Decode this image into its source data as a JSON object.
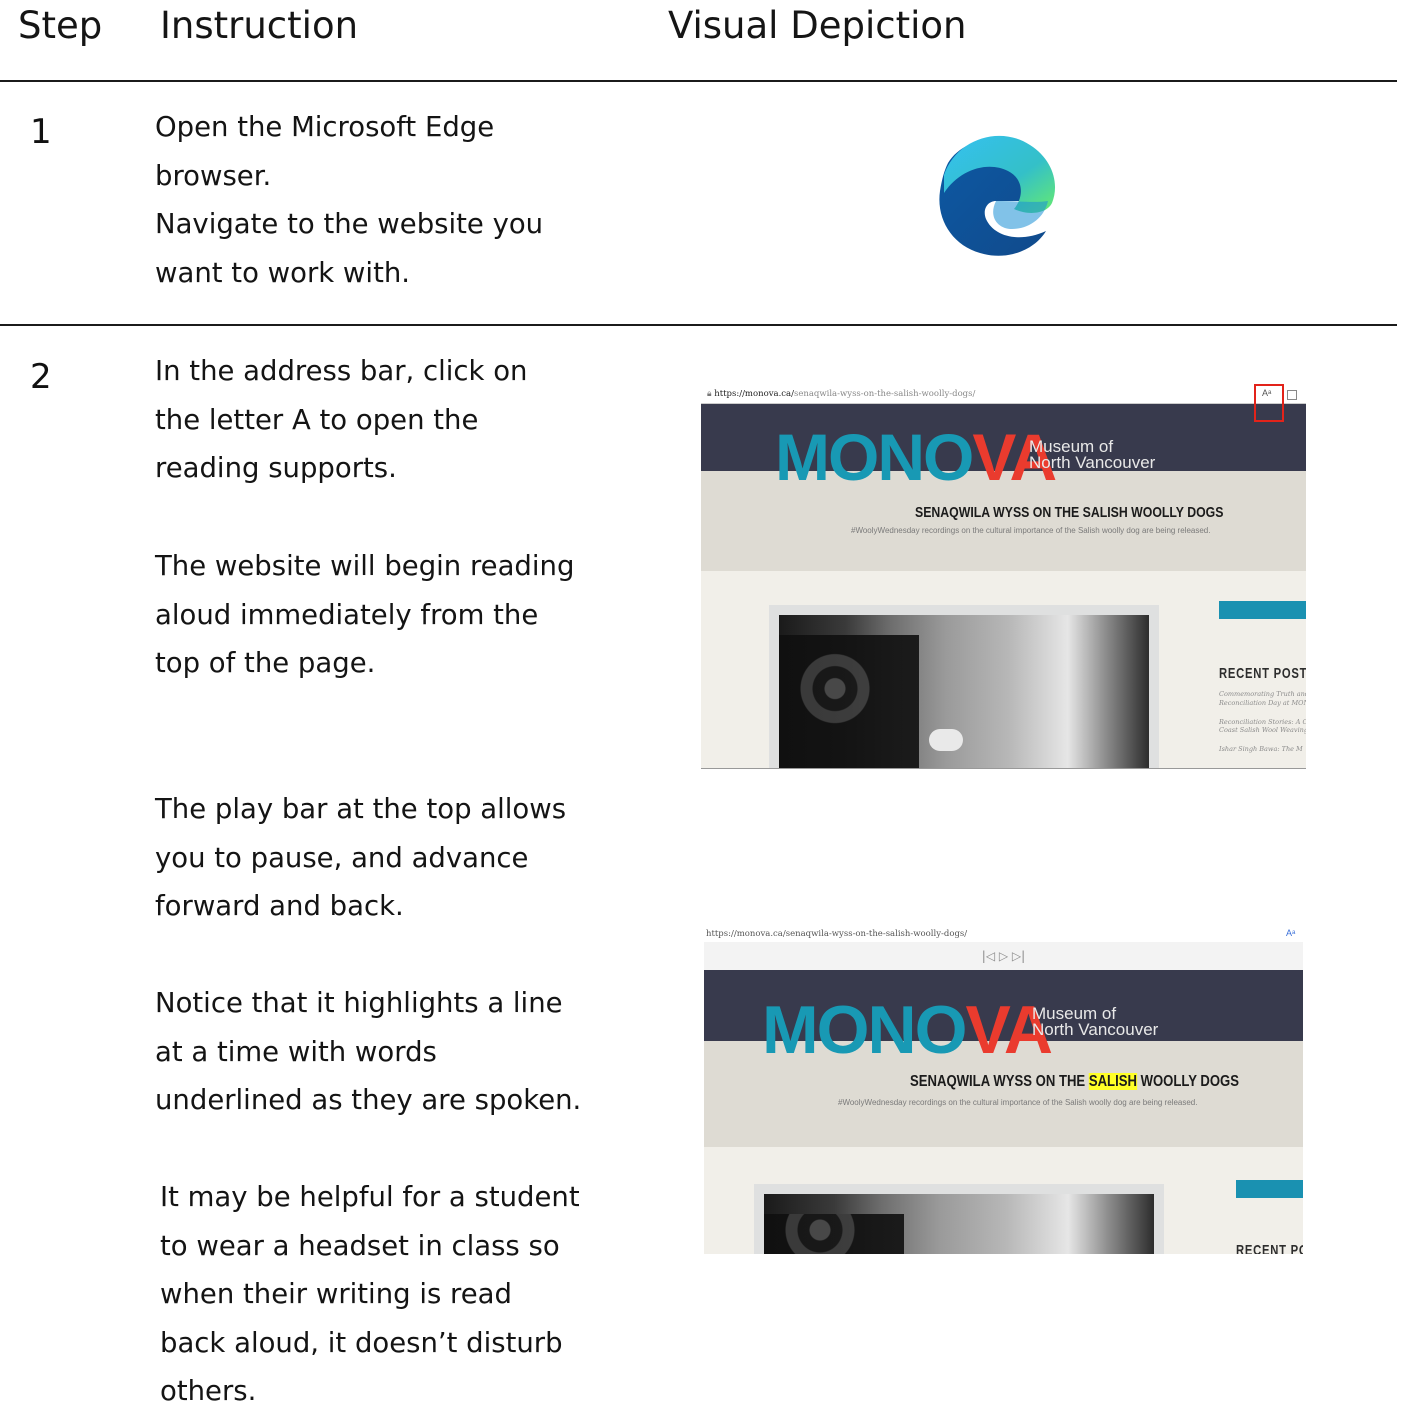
{
  "headers": {
    "step": "Step",
    "instruction": "Instruction",
    "visual": "Visual Depiction"
  },
  "rows": [
    {
      "step": "1",
      "lines": [
        "Open the Microsoft Edge",
        "browser.",
        "Navigate to the website you",
        "want to work with."
      ]
    },
    {
      "step": "2",
      "paragraphs": [
        [
          "In the address bar, click on",
          "the letter A to open the",
          "reading supports."
        ],
        [
          "The website will begin reading",
          "aloud immediately from the",
          "top of the page."
        ],
        [
          "The play bar at the top allows",
          "you to pause, and advance",
          "forward and back."
        ],
        [
          "Notice that it highlights a line",
          "at a time with words",
          "underlined as they are spoken."
        ],
        [
          "It may be helpful for a student",
          "to wear a headset in class so",
          "when their writing is read",
          "back aloud, it doesn’t disturb",
          "others."
        ]
      ]
    }
  ],
  "icons": {
    "edge": "microsoft-edge-icon",
    "read_aloud": "read-aloud-icon",
    "lock": "lock-icon"
  },
  "screenshot_1": {
    "url_host": "https://monova.ca/",
    "url_path": "senaqwila-wyss-on-the-salish-woolly-dogs/",
    "logo": "MONOVA",
    "museum_line1": "Museum of",
    "museum_line2": "North Vancouver",
    "post_title": "SENAQWILA WYSS ON THE SALISH WOOLLY DOGS",
    "post_sub": "#WoolyWednesday recordings on the cultural importance of the Salish woolly dog are being released.",
    "recent_posts": "RECENT POSTS",
    "side_items": [
      "Commemorating Truth and",
      "Reconciliation Day at MON",
      "Reconciliation Stories: A C",
      "Coast Salish Wool Weaving",
      "Ishar Singh Bawa: The M"
    ]
  },
  "screenshot_2": {
    "url": "https://monova.ca/senaqwila-wyss-on-the-salish-woolly-dogs/",
    "playbar": "|◁   ▷   ▷|",
    "logo": "MONOVA",
    "museum_line1": "Museum of",
    "museum_line2": "North Vancouver",
    "post_title_before": "SENAQWILA WYSS ON THE ",
    "post_title_highlight": "SALISH",
    "post_title_after": " WOOLLY DOGS",
    "post_sub": "#WoolyWednesday recordings on the cultural importance of the Salish woolly dog are being released.",
    "recent_posts": "RECENT PO"
  },
  "colors": {
    "highlight": "#ffff27",
    "banner": "#383a4d",
    "logo_teal": "#1899b4",
    "logo_red": "#ea3b2e",
    "callout": "#e2231a"
  }
}
